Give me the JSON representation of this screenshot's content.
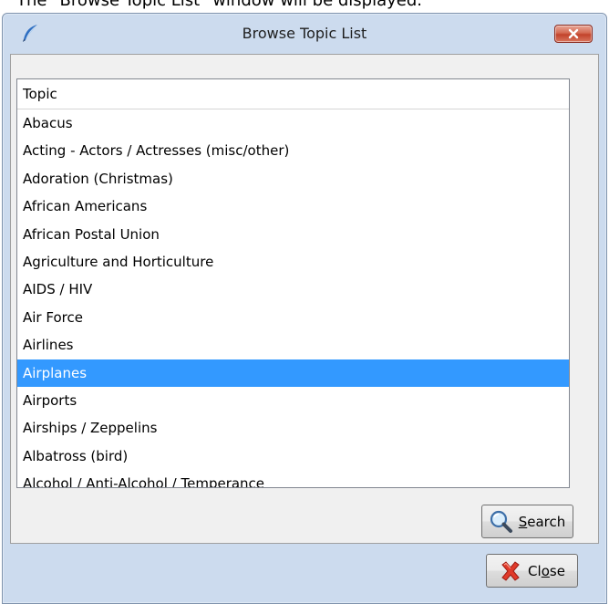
{
  "caption": "The \"Browse Topic List\" window will be displayed.",
  "window": {
    "title": "Browse Topic List",
    "app_icon": "quill-icon",
    "close_icon": "close-x-icon"
  },
  "list": {
    "header": "Topic",
    "items": [
      "Abacus",
      "Acting - Actors / Actresses (misc/other)",
      "Adoration (Christmas)",
      "African Americans",
      "African Postal Union",
      "Agriculture and Horticulture",
      "AIDS / HIV",
      "Air Force",
      "Airlines",
      "Airplanes",
      "Airports",
      "Airships / Zeppelins",
      "Albatross (bird)",
      "Alcohol / Anti-Alcohol / Temperance"
    ],
    "selected_item": "Airplanes"
  },
  "buttons": {
    "search": {
      "label_pre": "",
      "label_accel": "S",
      "label_post": "earch",
      "icon": "magnifier-icon"
    },
    "close": {
      "label_pre": "Cl",
      "label_accel": "o",
      "label_post": "se",
      "icon": "red-x-icon"
    }
  },
  "colors": {
    "selection": "#3399ff",
    "window_frame": "#ccdbee",
    "titlebar_close": "#c2432b"
  }
}
